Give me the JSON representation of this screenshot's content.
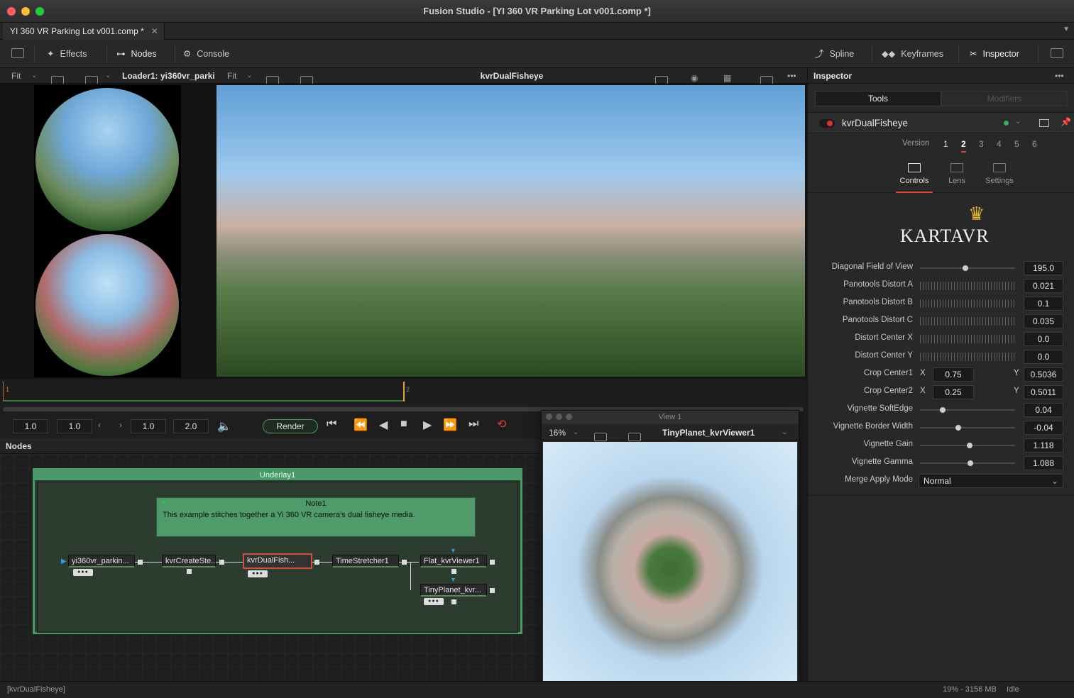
{
  "window": {
    "title": "Fusion Studio - [YI 360 VR Parking Lot v001.comp *]"
  },
  "tab": {
    "label": "YI 360 VR Parking Lot v001.comp *"
  },
  "toolbar": {
    "effects": "Effects",
    "nodes": "Nodes",
    "console": "Console",
    "spline": "Spline",
    "keyframes": "Keyframes",
    "inspector": "Inspector"
  },
  "viewer_left": {
    "fit": "Fit",
    "label": "Loader1: yi360vr_parki"
  },
  "viewer_main": {
    "fit": "Fit",
    "title": "kvrDualFisheye"
  },
  "timeline": {
    "marker_start": "1",
    "marker_end": "2"
  },
  "transport": {
    "in": "1.0",
    "start": "1.0",
    "current": "1.0",
    "end": "2.0",
    "render": "Render"
  },
  "nodes_panel": {
    "label": "Nodes",
    "underlay": "Underlay1",
    "note_title": "Note1",
    "note_text": "This example stitches together a Yi 360 VR camera's dual fisheye media.",
    "nodes": [
      "yi360vr_parkin...",
      "kvrCreateSte...",
      "kvrDualFish...",
      "TimeStretcher1",
      "Flat_kvrViewer1",
      "TinyPlanet_kvr..."
    ]
  },
  "view1": {
    "title": "View 1",
    "zoom": "16%",
    "label": "TinyPlanet_kvrViewer1"
  },
  "inspector": {
    "title": "Inspector",
    "tabs": [
      "Tools",
      "Modifiers"
    ],
    "tool_name": "kvrDualFisheye",
    "version_label": "Version",
    "versions": [
      "1",
      "2",
      "3",
      "4",
      "5",
      "6"
    ],
    "subtabs": [
      "Controls",
      "Lens",
      "Settings"
    ],
    "logo": "KARTAVR",
    "params": [
      {
        "label": "Diagonal Field of View",
        "value": "195.0",
        "level": 0.48
      },
      {
        "label": "Panotools Distort A",
        "value": "0.021"
      },
      {
        "label": "Panotools Distort B",
        "value": "0.1"
      },
      {
        "label": "Panotools Distort C",
        "value": "0.035"
      },
      {
        "label": "Distort Center X",
        "value": "0.0"
      },
      {
        "label": "Distort Center Y",
        "value": "0.0"
      }
    ],
    "crop1": {
      "label": "Crop Center1",
      "x_label": "X",
      "x": "0.75",
      "y_label": "Y",
      "y": "0.5036"
    },
    "crop2": {
      "label": "Crop Center2",
      "x_label": "X",
      "x": "0.25",
      "y_label": "Y",
      "y": "0.5011"
    },
    "params2": [
      {
        "label": "Vignette SoftEdge",
        "value": "0.04",
        "level": 0.22
      },
      {
        "label": "Vignette Border Width",
        "value": "-0.04",
        "level": 0.4
      },
      {
        "label": "Vignette Gain",
        "value": "1.118",
        "level": 0.52
      },
      {
        "label": "Vignette Gamma",
        "value": "1.088",
        "level": 0.53
      }
    ],
    "merge_label": "Merge Apply Mode",
    "merge_value": "Normal"
  },
  "status": {
    "left": "[kvrDualFisheye]",
    "memory": "19% - 3156 MB",
    "state": "Idle"
  }
}
